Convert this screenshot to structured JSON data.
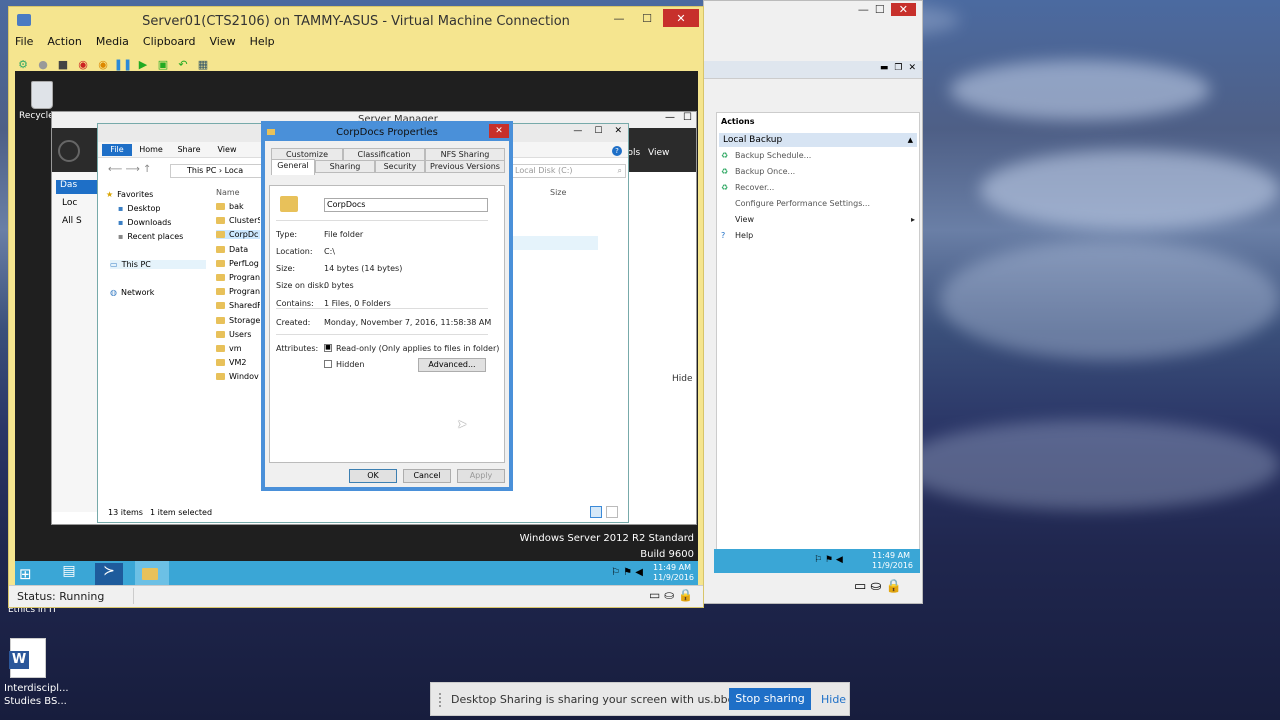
{
  "vm_window": {
    "title": "Server01(CTS2106) on TAMMY-ASUS - Virtual Machine Connection",
    "menu": [
      "File",
      "Action",
      "Media",
      "Clipboard",
      "View",
      "Help"
    ],
    "status": "Status: Running"
  },
  "desktop": {
    "recycle_label": "Recycle",
    "ethics_label": "Ethics in IT",
    "word_label_1": "Interdiscipl...",
    "word_label_2": "Studies BS..."
  },
  "server_manager": {
    "title": "Server Manager",
    "hide_label": "Hide",
    "tools_label": "ools",
    "view_label": "View"
  },
  "explorer": {
    "ribbon_tabs": [
      "File",
      "Home",
      "Share",
      "View"
    ],
    "address": "This PC  ›  Loca",
    "search_placeholder": "Local Disk (C:)",
    "col_name": "Name",
    "col_size": "Size",
    "nav": {
      "favorites": "Favorites",
      "desktop": "Desktop",
      "downloads": "Downloads",
      "recent": "Recent places",
      "thispc": "This PC",
      "network": "Network"
    },
    "files": [
      "bak",
      "ClusterS",
      "CorpDc",
      "Data",
      "PerfLog",
      "Progran",
      "Progran",
      "SharedF",
      "Storage",
      "Users",
      "vm",
      "VM2",
      "Windov"
    ],
    "status_items": "13 items",
    "status_selected": "1 item selected",
    "left_labels": [
      "Das",
      "Loc",
      "All S"
    ]
  },
  "dialog": {
    "title": "CorpDocs Properties",
    "tabs_top": [
      "Customize",
      "Classification",
      "NFS Sharing"
    ],
    "tabs_bottom": [
      "General",
      "Sharing",
      "Security",
      "Previous Versions"
    ],
    "name_value": "CorpDocs",
    "rows": [
      {
        "label": "Type:",
        "value": "File folder"
      },
      {
        "label": "Location:",
        "value": "C:\\"
      },
      {
        "label": "Size:",
        "value": "14 bytes (14 bytes)"
      },
      {
        "label": "Size on disk:",
        "value": "0 bytes"
      },
      {
        "label": "Contains:",
        "value": "1 Files, 0 Folders"
      }
    ],
    "created_label": "Created:",
    "created_value": "Monday, November 7, 2016, 11:58:38 AM",
    "attributes_label": "Attributes:",
    "readonly_label": "Read-only (Only applies to files in folder)",
    "hidden_label": "Hidden",
    "advanced_label": "Advanced...",
    "ok": "OK",
    "cancel": "Cancel",
    "apply": "Apply"
  },
  "guest_taskbar": {
    "edition": "Windows Server 2012 R2 Standard",
    "build": "Build 9600",
    "time": "11:49 AM",
    "date": "11/9/2016"
  },
  "right_pane": {
    "actions_header": "Actions",
    "section": "Local Backup",
    "items": [
      "Backup Schedule...",
      "Backup Once...",
      "Recover...",
      "Configure Performance Settings...",
      "View",
      "Help"
    ],
    "time": "11:49 AM",
    "date": "11/9/2016"
  },
  "sharing_bar": {
    "message": "Desktop Sharing is sharing your screen with us.bbcollab.com.",
    "stop": "Stop sharing",
    "hide": "Hide"
  },
  "colors": {
    "accent": "#1e6fc7",
    "taskbar": "#3aa6d6",
    "vm_frame": "#f5e58f"
  }
}
